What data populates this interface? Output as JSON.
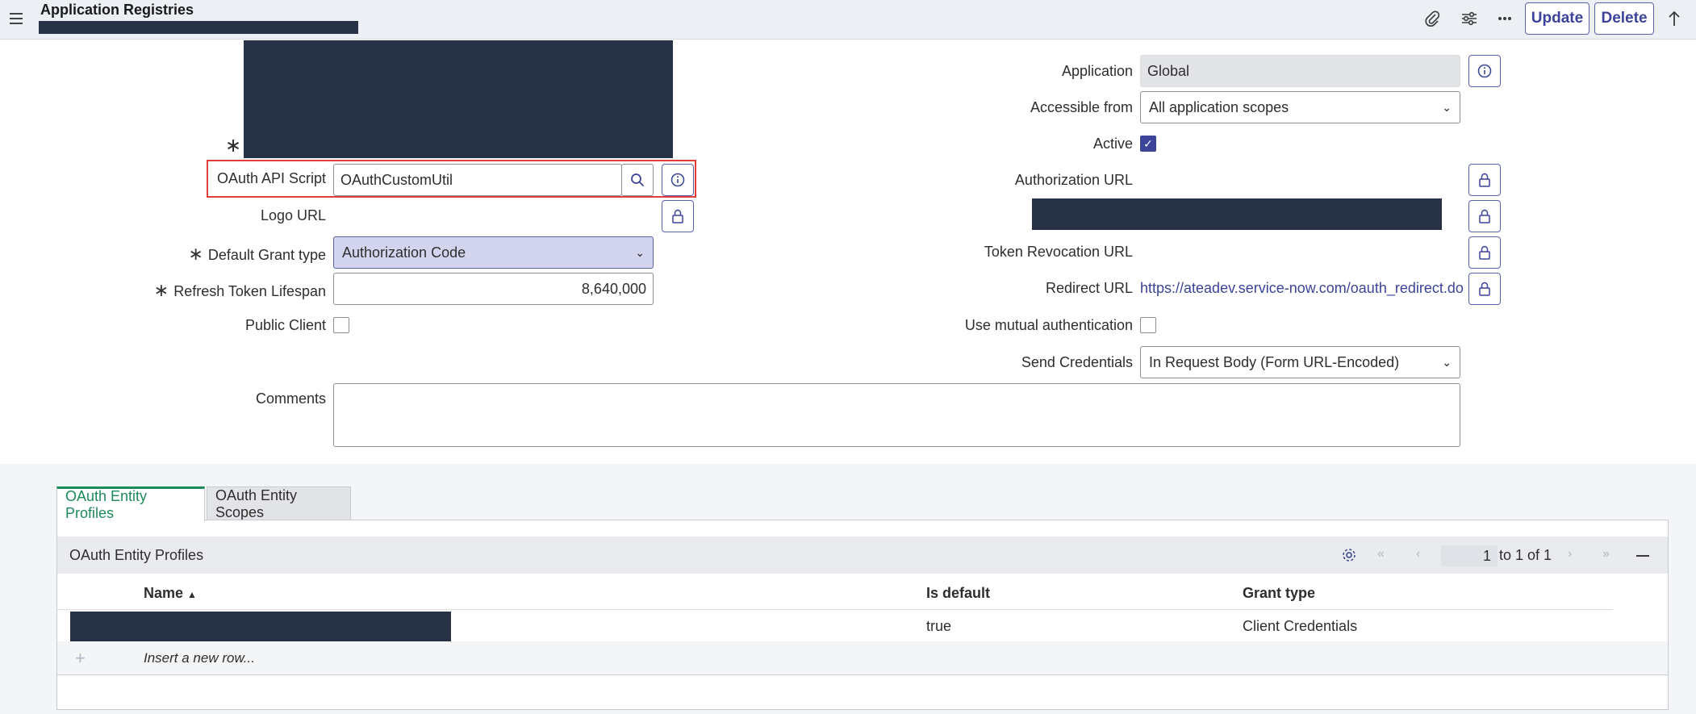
{
  "header": {
    "title": "Application Registries",
    "update_label": "Update",
    "delete_label": "Delete"
  },
  "form": {
    "oauth_api_script": {
      "label": "OAuth API Script",
      "value": "OAuthCustomUtil"
    },
    "logo_url": {
      "label": "Logo URL"
    },
    "default_grant_type": {
      "label": "Default Grant type",
      "value": "Authorization Code"
    },
    "refresh_token_lifespan": {
      "label": "Refresh Token Lifespan",
      "value": "8,640,000"
    },
    "public_client": {
      "label": "Public Client"
    },
    "comments": {
      "label": "Comments"
    },
    "application": {
      "label": "Application",
      "value": "Global"
    },
    "accessible_from": {
      "label": "Accessible from",
      "value": "All application scopes"
    },
    "active": {
      "label": "Active"
    },
    "authorization_url": {
      "label": "Authorization URL"
    },
    "token_revocation_url": {
      "label": "Token Revocation URL"
    },
    "redirect_url": {
      "label": "Redirect URL",
      "value": "https://ateadev.service-now.com/oauth_redirect.do"
    },
    "mutual_auth": {
      "label": "Use mutual authentication"
    },
    "send_credentials": {
      "label": "Send Credentials",
      "value": "In Request Body (Form URL-Encoded)"
    }
  },
  "tabs": [
    {
      "label": "OAuth Entity Profiles"
    },
    {
      "label": "OAuth Entity Scopes"
    }
  ],
  "related_list": {
    "title": "OAuth Entity Profiles",
    "page_current": "1",
    "page_suffix": "to 1 of 1",
    "columns": [
      "Name",
      "Is default",
      "Grant type"
    ],
    "rows": [
      {
        "is_default": "true",
        "grant_type": "Client Credentials"
      }
    ],
    "insert_row": "Insert a new row..."
  },
  "colors": {
    "accent": "#3b4499",
    "highlight": "#e03c3c",
    "tab_active": "#1e8a5b",
    "redacted": "#283246"
  }
}
